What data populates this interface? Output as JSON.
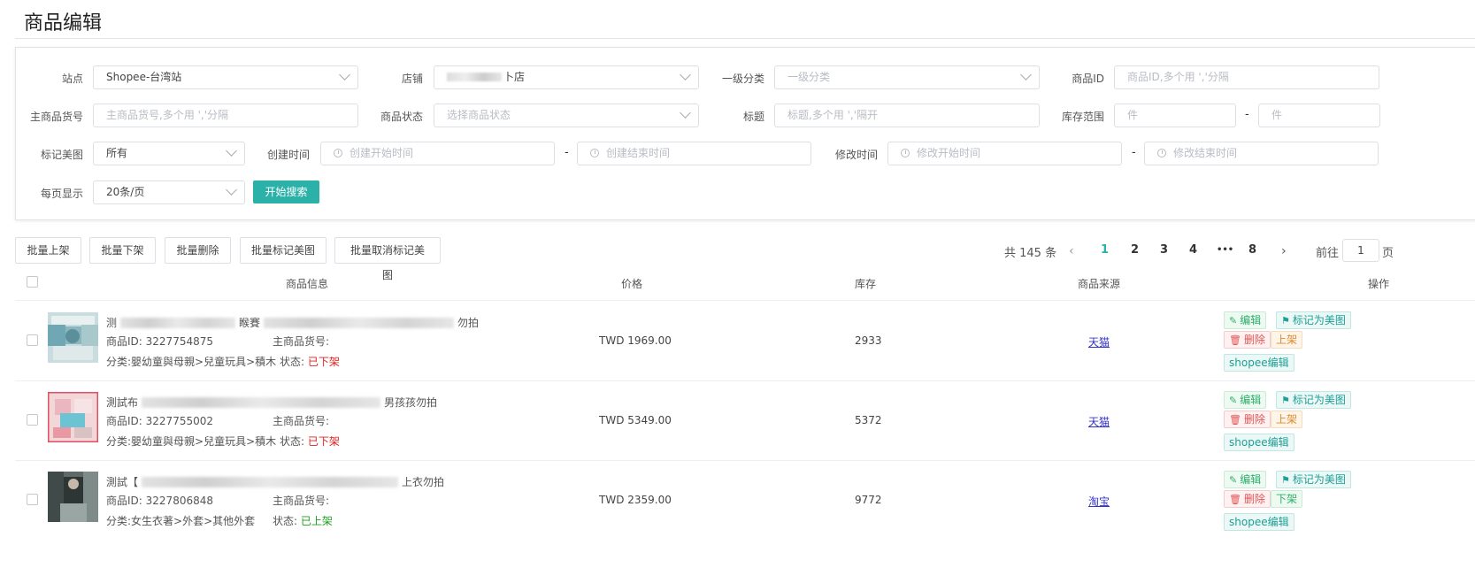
{
  "page": {
    "title": "商品编辑"
  },
  "filters": {
    "site": {
      "label": "站点",
      "value": "Shopee-台湾站"
    },
    "store": {
      "label": "店铺",
      "value": "卜店"
    },
    "category": {
      "label": "一级分类",
      "placeholder": "一级分类"
    },
    "product_id": {
      "label": "商品ID",
      "placeholder": "商品ID,多个用 ','分隔"
    },
    "main_sku": {
      "label": "主商品货号",
      "placeholder": "主商品货号,多个用 ','分隔"
    },
    "status": {
      "label": "商品状态",
      "placeholder": "选择商品状态"
    },
    "title": {
      "label": "标题",
      "placeholder": "标题,多个用 ','隔开"
    },
    "stock_range": {
      "label": "库存范围",
      "min_placeholder": "件",
      "max_placeholder": "件",
      "dash": "-"
    },
    "mark_image": {
      "label": "标记美图",
      "value": "所有"
    },
    "created": {
      "label": "创建时间",
      "start_placeholder": "创建开始时间",
      "end_placeholder": "创建结束时间",
      "dash": "-"
    },
    "modified": {
      "label": "修改时间",
      "start_placeholder": "修改开始时间",
      "end_placeholder": "修改结束时间",
      "dash": "-"
    },
    "per_page": {
      "label": "每页显示",
      "value": "20条/页"
    },
    "search_button": "开始搜索"
  },
  "batch": [
    "批量上架",
    "批量下架",
    "批量删除",
    "批量标记美图",
    "批量取消标记美图"
  ],
  "pager": {
    "total": "共 145 条",
    "prev": "‹",
    "next": "›",
    "pages": [
      "1",
      "2",
      "3",
      "4",
      "•••",
      "8"
    ],
    "active": "1",
    "goto_label": "前往",
    "goto_value": "1",
    "goto_tail": "页"
  },
  "table": {
    "headers": {
      "info": "商品信息",
      "price": "价格",
      "stock": "库存",
      "source": "商品来源",
      "actions": "操作"
    },
    "rows": [
      {
        "title_start": "测",
        "title_mid": "睺賽",
        "title_end": "勿拍",
        "id_label": "商品ID:",
        "id": "3227754875",
        "sku_label": "主商品货号:",
        "category_label": "分类:",
        "category": "嬰幼童與母親>兒童玩具>積木",
        "status_label": "状态:",
        "status": "已下架",
        "status_type": "off",
        "price": "TWD 1969.00",
        "stock": "2933",
        "source": "天猫",
        "actions": {
          "edit": "编辑",
          "mark": "标记为美图",
          "delete": "删除",
          "toggle": "上架",
          "shopee": "shopee编辑"
        }
      },
      {
        "title_start": "測試布",
        "title_mid": "男孩",
        "title_end": "孩勿拍",
        "id_label": "商品ID:",
        "id": "3227755002",
        "sku_label": "主商品货号:",
        "category_label": "分类:",
        "category": "嬰幼童與母親>兒童玩具>積木",
        "status_label": "状态:",
        "status": "已下架",
        "status_type": "off",
        "price": "TWD 5349.00",
        "stock": "5372",
        "source": "天猫",
        "actions": {
          "edit": "编辑",
          "mark": "标记为美图",
          "delete": "删除",
          "toggle": "上架",
          "shopee": "shopee编辑"
        }
      },
      {
        "title_start": "測試【",
        "title_mid": "",
        "title_end": "上衣勿拍",
        "id_label": "商品ID:",
        "id": "3227806848",
        "sku_label": "主商品货号:",
        "category_label": "分类:",
        "category": "女生衣著>外套>其他外套",
        "status_label": "状态:",
        "status": "已上架",
        "status_type": "on",
        "price": "TWD 2359.00",
        "stock": "9772",
        "source": "淘宝",
        "actions": {
          "edit": "编辑",
          "mark": "标记为美图",
          "delete": "删除",
          "toggle": "下架",
          "shopee": "shopee编辑"
        }
      }
    ]
  },
  "colors": {
    "accent": "#2bb1a8",
    "off": "#e02020",
    "on": "#20a020"
  }
}
